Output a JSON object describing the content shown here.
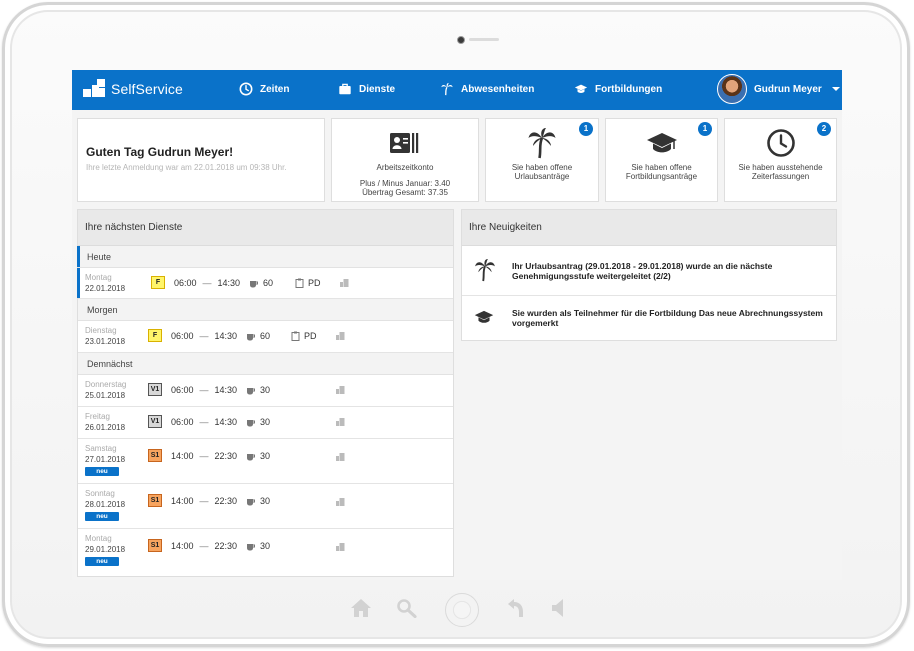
{
  "app": {
    "name": "SelfService"
  },
  "nav": [
    {
      "label": "Zeiten",
      "icon": "clock-icon"
    },
    {
      "label": "Dienste",
      "icon": "briefcase-icon"
    },
    {
      "label": "Abwesenheiten",
      "icon": "palm-tree-icon"
    },
    {
      "label": "Fortbildungen",
      "icon": "graduation-cap-icon"
    }
  ],
  "user": {
    "name": "Gudrun Meyer"
  },
  "welcome": {
    "greeting": "Guten Tag Gudrun Meyer!",
    "last_login": "Ihre letzte Anmeldung war am 22.01.2018 um 09:38 Uhr."
  },
  "cards": [
    {
      "icon": "account-card-icon",
      "title": "Arbeitszeitkonto",
      "line1": "Plus / Minus Januar: 3.40",
      "line2": "Übertrag Gesamt: 37.35"
    },
    {
      "icon": "palm-tree-icon",
      "title": "Sie haben offene Urlaubsanträge",
      "badge": "1"
    },
    {
      "icon": "graduation-cap-icon",
      "title": "Sie haben offene Fortbildungsanträge",
      "badge": "1"
    },
    {
      "icon": "clock-icon",
      "title": "Sie haben ausstehende Zeiterfassungen",
      "badge": "2"
    }
  ],
  "duties": {
    "title": "Ihre nächsten Dienste",
    "sections": {
      "today": "Heute",
      "tomorrow": "Morgen",
      "upcoming": "Demnächst"
    },
    "rows": [
      {
        "day": "Montag",
        "date": "22.01.2018",
        "code": "F",
        "start": "06:00",
        "end": "14:30",
        "pause": "60",
        "qual": "PD"
      },
      {
        "day": "Dienstag",
        "date": "23.01.2018",
        "code": "F",
        "start": "06:00",
        "end": "14:30",
        "pause": "60",
        "qual": "PD"
      },
      {
        "day": "Donnerstag",
        "date": "25.01.2018",
        "code": "V1",
        "start": "06:00",
        "end": "14:30",
        "pause": "30"
      },
      {
        "day": "Freitag",
        "date": "26.01.2018",
        "code": "V1",
        "start": "06:00",
        "end": "14:30",
        "pause": "30"
      },
      {
        "day": "Samstag",
        "date": "27.01.2018",
        "code": "S1",
        "start": "14:00",
        "end": "22:30",
        "pause": "30",
        "badge": "neu"
      },
      {
        "day": "Sonntag",
        "date": "28.01.2018",
        "code": "S1",
        "start": "14:00",
        "end": "22:30",
        "pause": "30",
        "badge": "neu"
      },
      {
        "day": "Montag",
        "date": "29.01.2018",
        "code": "S1",
        "start": "14:00",
        "end": "22:30",
        "pause": "30",
        "badge": "neu"
      }
    ],
    "dash": "—"
  },
  "news": {
    "title": "Ihre Neuigkeiten",
    "items": [
      {
        "icon": "palm-tree-icon",
        "text": "Ihr Urlaubsantrag (29.01.2018 - 29.01.2018) wurde an die nächste Genehmigungsstufe weitergeleitet (2/2)"
      },
      {
        "icon": "graduation-cap-icon",
        "text": "Sie wurden als Teilnehmer für die Fortbildung Das neue Abrechnungssystem vorgemerkt"
      }
    ]
  },
  "colors": {
    "brand": "#0a72c9",
    "code_F": "#fff56a",
    "code_V1": "#d8d8d8",
    "code_S1": "#f7a45f"
  }
}
